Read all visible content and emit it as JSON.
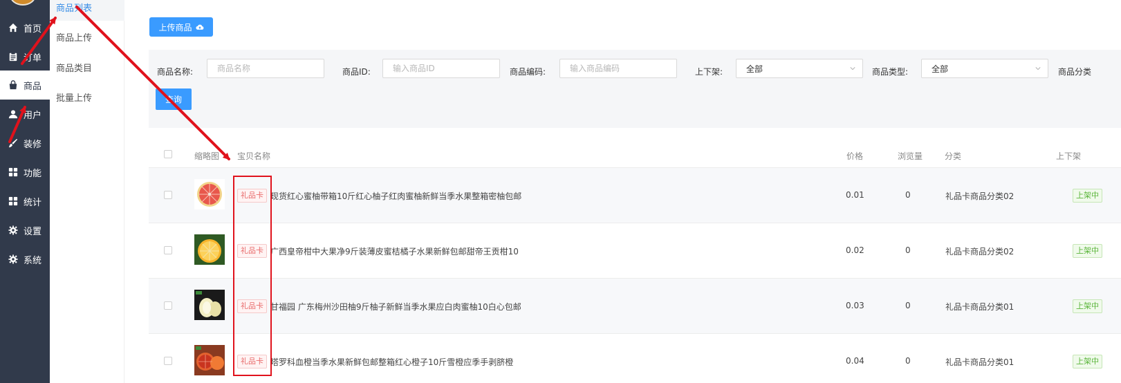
{
  "sidebar": {
    "items": [
      {
        "label": "首页",
        "icon": "home-icon"
      },
      {
        "label": "订单",
        "icon": "clipboard-icon"
      },
      {
        "label": "商品",
        "icon": "shopping-bag-icon",
        "active": true
      },
      {
        "label": "用户",
        "icon": "user-icon"
      },
      {
        "label": "装修",
        "icon": "brush-icon"
      },
      {
        "label": "功能",
        "icon": "grid-icon"
      },
      {
        "label": "统计",
        "icon": "grid-icon"
      },
      {
        "label": "设置",
        "icon": "gear-icon"
      },
      {
        "label": "系统",
        "icon": "gear-icon"
      }
    ]
  },
  "submenu": {
    "items": [
      {
        "label": "商品列表",
        "active": true
      },
      {
        "label": "商品上传"
      },
      {
        "label": "商品类目"
      },
      {
        "label": "批量上传"
      }
    ]
  },
  "toolbar": {
    "upload_label": "上传商品",
    "upload_icon": "cloud-upload-icon"
  },
  "filters": {
    "name_label": "商品名称:",
    "name_placeholder": "商品名称",
    "id_label": "商品ID:",
    "id_placeholder": "输入商品ID",
    "code_label": "商品编码:",
    "code_placeholder": "输入商品编码",
    "shelf_label": "上下架:",
    "shelf_value": "全部",
    "type_label": "商品类型:",
    "type_value": "全部",
    "category_label": "商品分类",
    "query_label": "查询"
  },
  "table": {
    "headers": {
      "thumb": "缩略图",
      "name": "宝贝名称",
      "price": "价格",
      "views": "浏览量",
      "category": "分类",
      "status": "上下架"
    },
    "rows": [
      {
        "tag": "礼品卡",
        "name": "现货红心蜜柚带箱10斤红心柚子红肉蜜柚新鲜当季水果整箱密柚包邮",
        "price": "0.01",
        "views": "0",
        "category": "礼品卡商品分类02",
        "status": "上架中",
        "thumb": "red-grapefruit-image"
      },
      {
        "tag": "礼品卡",
        "name": "广西皇帝柑中大果净9斤装薄皮蜜桔橘子水果新鲜包邮甜帝王贡柑10",
        "price": "0.02",
        "views": "0",
        "category": "礼品卡商品分类02",
        "status": "上架中",
        "thumb": "orange-image"
      },
      {
        "tag": "礼品卡",
        "name": "甘福园 广东梅州沙田柚9斤柚子新鲜当季水果应白肉蜜柚10白心包邮",
        "price": "0.03",
        "views": "0",
        "category": "礼品卡商品分类01",
        "status": "上架中",
        "thumb": "pomelo-image"
      },
      {
        "tag": "礼品卡",
        "name": "塔罗科血橙当季水果新鲜包邮整箱红心橙子10斤雪橙应季手剥脐橙",
        "price": "0.04",
        "views": "0",
        "category": "礼品卡商品分类01",
        "status": "上架中",
        "thumb": "blood-orange-image"
      }
    ]
  },
  "annotation_color": "#e0121c",
  "accent_color": "#3a9bff"
}
